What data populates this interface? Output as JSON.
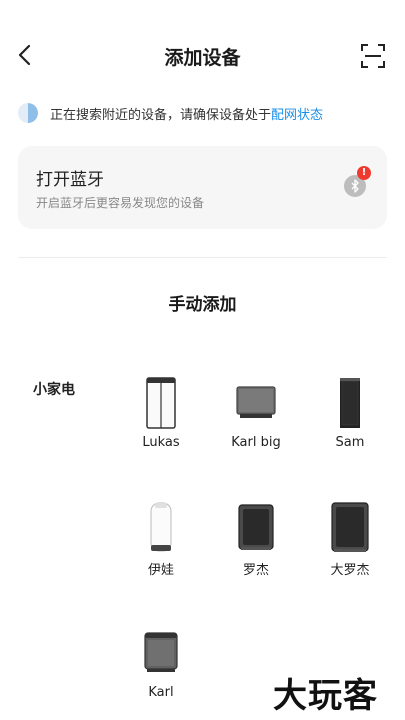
{
  "header": {
    "title": "添加设备",
    "back_icon": "chevron-left-icon",
    "scan_icon": "scan-icon"
  },
  "search_status": {
    "text": "正在搜索附近的设备，请确保设备处于",
    "link": "配网状态"
  },
  "bluetooth_card": {
    "title": "打开蓝牙",
    "subtitle": "开启蓝牙后更容易发现您的设备",
    "icon": "bluetooth-icon",
    "badge": "!"
  },
  "manual_add": {
    "title": "手动添加"
  },
  "category": {
    "label": "小家电"
  },
  "devices": [
    {
      "label": "Lukas",
      "icon": "lukas-device-icon"
    },
    {
      "label": "Karl big",
      "icon": "karl-big-device-icon"
    },
    {
      "label": "Sam",
      "icon": "sam-device-icon"
    },
    {
      "label": "伊娃",
      "icon": "eva-device-icon"
    },
    {
      "label": "罗杰",
      "icon": "roger-device-icon"
    },
    {
      "label": "大罗杰",
      "icon": "big-roger-device-icon"
    },
    {
      "label": "Karl",
      "icon": "karl-device-icon"
    }
  ],
  "watermark": {
    "text": "大玩客"
  },
  "colors": {
    "link": "#1a8ee8",
    "badge": "#ee3a2f",
    "card_bg": "#f6f6f6"
  }
}
